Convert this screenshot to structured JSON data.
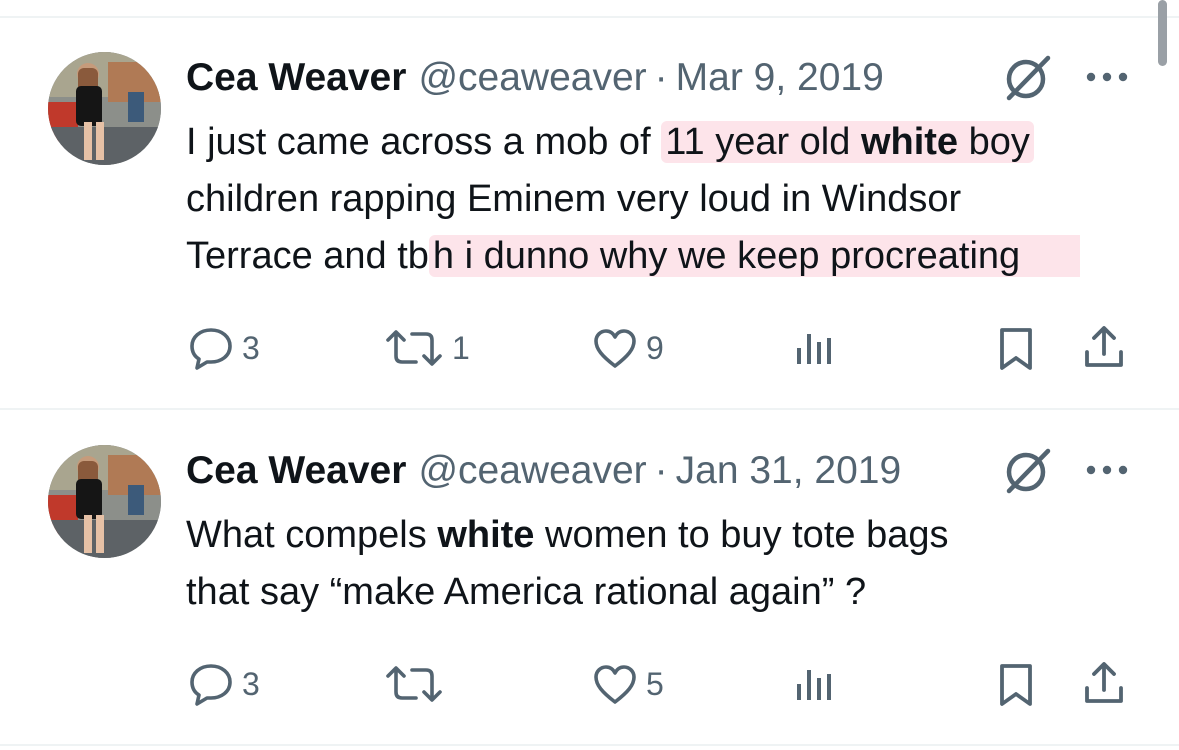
{
  "colors": {
    "text": "#0f1419",
    "muted": "#536471",
    "highlight": "#fde4ea",
    "divider": "#eff3f4"
  },
  "tweets": [
    {
      "author": {
        "name": "Cea Weaver",
        "handle": "@ceaweaver"
      },
      "separator": "·",
      "date": "Mar 9, 2019",
      "text": {
        "line1_a": "I just came across a mob of ",
        "line1_hl_a": "11 year old ",
        "line1_bold": "white",
        "line1_hl_b": " boy",
        "line2": "children rapping Eminem very loud in Windsor",
        "line3_a": "Terrace and tb",
        "line3_hl": "h i dunno why we keep procreating"
      },
      "stats": {
        "replies": "3",
        "retweets": "1",
        "likes": "9",
        "views": ""
      },
      "icons": [
        "avatar-photo",
        "grok-icon",
        "more-icon",
        "reply-icon",
        "retweet-icon",
        "like-icon",
        "views-icon",
        "bookmark-icon",
        "share-icon"
      ]
    },
    {
      "author": {
        "name": "Cea Weaver",
        "handle": "@ceaweaver"
      },
      "separator": "·",
      "date": "Jan 31, 2019",
      "text": {
        "line1_a": "What compels ",
        "line1_bold": "white",
        "line1_b": " women to buy tote bags",
        "line2": "that say “make America rational again” ?"
      },
      "stats": {
        "replies": "3",
        "retweets": "",
        "likes": "5",
        "views": ""
      },
      "icons": [
        "avatar-photo",
        "grok-icon",
        "more-icon",
        "reply-icon",
        "retweet-icon",
        "like-icon",
        "views-icon",
        "bookmark-icon",
        "share-icon"
      ]
    }
  ]
}
